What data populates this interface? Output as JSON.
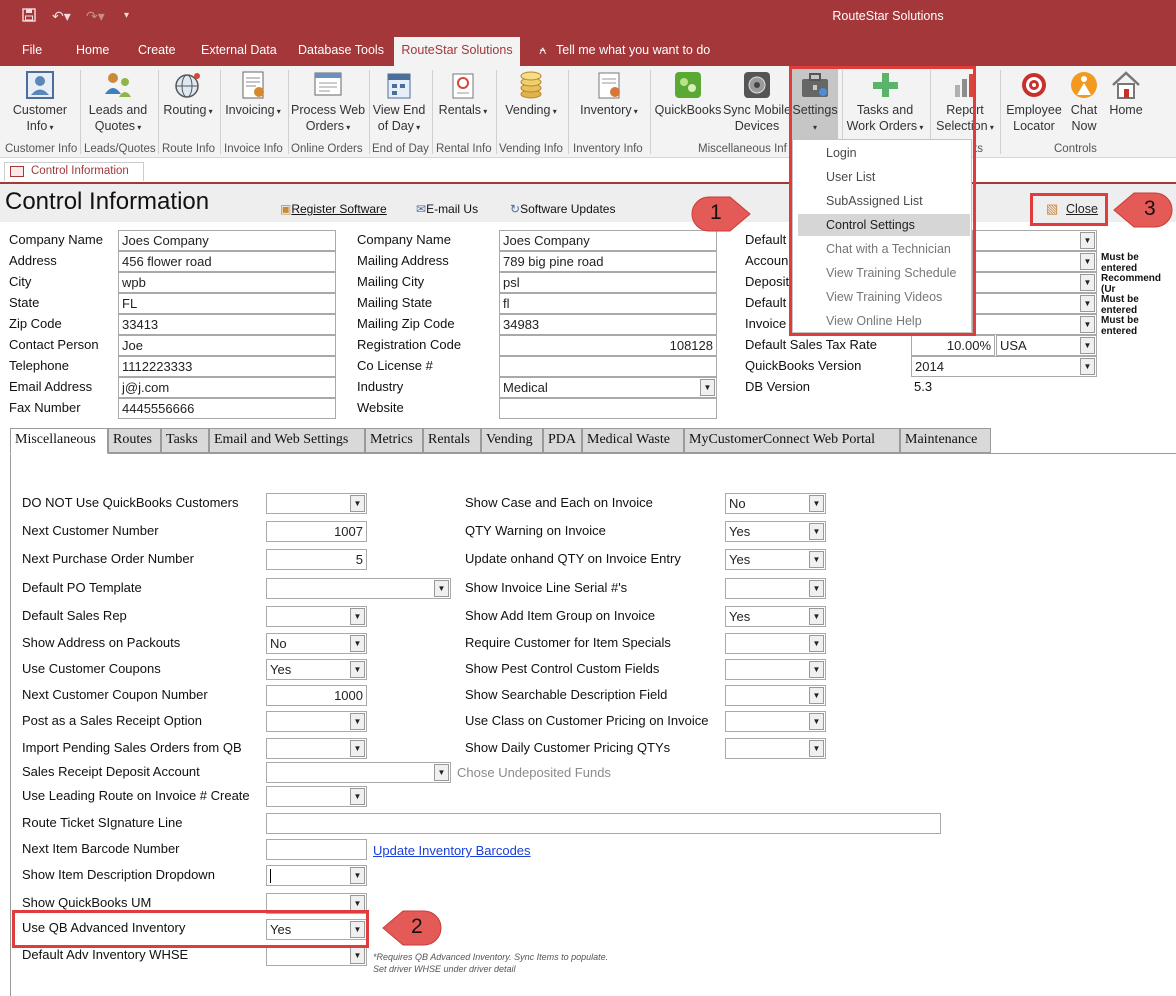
{
  "window": {
    "title": "RouteStar Solutions"
  },
  "menu_tabs": [
    "File",
    "Home",
    "Create",
    "External Data",
    "Database Tools",
    "RouteStar Solutions",
    "Tell me what you want to do"
  ],
  "ribbon": {
    "buttons": [
      {
        "label": "Customer\nInfo",
        "icon": "customer-info-icon"
      },
      {
        "label": "Leads and\nQuotes",
        "icon": "leads-quotes-icon"
      },
      {
        "label": "Routing",
        "icon": "routing-globe-icon"
      },
      {
        "label": "Invoicing",
        "icon": "invoice-icon"
      },
      {
        "label": "Process Web\nOrders",
        "icon": "web-orders-icon"
      },
      {
        "label": "View End\nof Day",
        "icon": "end-of-day-icon"
      },
      {
        "label": "Rentals",
        "icon": "rentals-icon"
      },
      {
        "label": "Vending",
        "icon": "vending-coins-icon"
      },
      {
        "label": "Inventory",
        "icon": "inventory-icon"
      },
      {
        "label": "QuickBooks",
        "icon": "quickbooks-icon"
      },
      {
        "label": "Sync Mobile\nDevices",
        "icon": "sync-mobile-icon"
      },
      {
        "label": "Settings",
        "icon": "settings-toolbox-icon"
      },
      {
        "label": "Tasks and\nWork Orders",
        "icon": "tasks-plus-icon"
      },
      {
        "label": "Report\nSelection",
        "icon": "report-selection-icon"
      },
      {
        "label": "Employee\nLocator",
        "icon": "employee-locator-icon"
      },
      {
        "label": "Chat\nNow",
        "icon": "chat-now-icon"
      },
      {
        "label": "Home",
        "icon": "home-icon"
      }
    ],
    "groups": [
      "Customer Info",
      "Leads/Quotes",
      "Route Info",
      "Invoice Info",
      "Online Orders",
      "End of Day",
      "Rental Info",
      "Vending Info",
      "Inventory Info",
      "Miscellaneous Inf",
      "ts",
      "Controls"
    ]
  },
  "settings_menu": [
    "Login",
    "User List",
    "SubAssigned List",
    "Control Settings",
    "Chat with a Technician",
    "View Training Schedule",
    "View Training Videos",
    "View Online Help"
  ],
  "doc_tab": "Control Information",
  "header": {
    "title": "Control Information",
    "register": "Register Software",
    "email": "E-mail Us",
    "updates": "Software Updates",
    "close": "Close"
  },
  "company": {
    "labels": [
      "Company Name",
      "Address",
      "City",
      "State",
      "Zip Code",
      "Contact Person",
      "Telephone",
      "Email Address",
      "Fax Number"
    ],
    "values": [
      "Joes Company",
      "456 flower road",
      "wpb",
      "FL",
      "33413",
      "Joe",
      "1112223333",
      "j@j.com",
      "4445556666"
    ]
  },
  "mailing": {
    "labels": [
      "Company Name",
      "Mailing Address",
      "Mailing City",
      "Mailing State",
      "Mailing Zip Code",
      "Registration Code",
      "Co License #",
      "Industry",
      "Website"
    ],
    "values": [
      "Joes Company",
      "789 big pine road",
      "psl",
      "fl",
      "34983",
      "108128",
      "",
      "Medical",
      ""
    ]
  },
  "defaults": {
    "labels": [
      "Default",
      "Accoun",
      "Deposit",
      "Default",
      "Invoice",
      "Default Sales Tax Rate",
      "QuickBooks Version",
      "DB Version"
    ],
    "tax_rate": "10.00%",
    "tax_region": "USA",
    "qb_version": "2014",
    "db_version": "5.3",
    "notes": [
      "Must be entered",
      "Recommend (Ur",
      "Must be entered",
      "Must be entered"
    ]
  },
  "tabs": [
    "Miscellaneous",
    "Routes",
    "Tasks",
    "Email and Web Settings",
    "Metrics",
    "Rentals",
    "Vending",
    "PDA",
    "Medical Waste",
    "MyCustomerConnect Web Portal",
    "Maintenance"
  ],
  "misc_left": [
    {
      "label": "DO NOT Use QuickBooks Customers",
      "value": ""
    },
    {
      "label": "Next Customer Number",
      "value": "1007"
    },
    {
      "label": "Next Purchase Order Number",
      "value": "5"
    },
    {
      "label": "Default PO Template",
      "value": ""
    },
    {
      "label": "Default Sales Rep",
      "value": ""
    },
    {
      "label": "Show Address on Packouts",
      "value": "No"
    },
    {
      "label": "Use Customer Coupons",
      "value": "Yes"
    },
    {
      "label": "Next Customer Coupon Number",
      "value": "1000"
    },
    {
      "label": "Post as a Sales Receipt Option",
      "value": ""
    },
    {
      "label": "Import Pending Sales Orders from QB",
      "value": ""
    },
    {
      "label": "Sales Receipt Deposit Account",
      "value": ""
    },
    {
      "label": "Use Leading Route on Invoice # Create",
      "value": ""
    },
    {
      "label": "Route Ticket SIgnature Line",
      "value": ""
    },
    {
      "label": "Next Item Barcode Number",
      "value": ""
    },
    {
      "label": "Show Item Description Dropdown",
      "value": ""
    },
    {
      "label": "Show QuickBooks UM",
      "value": ""
    },
    {
      "label": "Use QB Advanced Inventory",
      "value": "Yes"
    },
    {
      "label": "Default Adv Inventory WHSE",
      "value": ""
    }
  ],
  "misc_right": [
    {
      "label": "Show Case and Each on Invoice",
      "value": "No"
    },
    {
      "label": "QTY Warning on Invoice",
      "value": "Yes"
    },
    {
      "label": "Update onhand QTY on Invoice Entry",
      "value": "Yes"
    },
    {
      "label": "Show Invoice Line Serial #'s",
      "value": ""
    },
    {
      "label": "Show Add Item Group on Invoice",
      "value": "Yes"
    },
    {
      "label": "Require Customer for Item Specials",
      "value": ""
    },
    {
      "label": "Show Pest Control Custom Fields",
      "value": ""
    },
    {
      "label": "Show Searchable Description Field",
      "value": ""
    },
    {
      "label": "Use Class on Customer Pricing on Invoice",
      "value": ""
    },
    {
      "label": "Show Daily Customer Pricing QTYs",
      "value": ""
    }
  ],
  "undeposited_hint": "Chose Undeposited Funds",
  "update_barcodes": "Update Inventory Barcodes",
  "adv_inventory_note": [
    "*Requires QB Advanced Inventory. Sync Items to populate.",
    "Set driver WHSE under driver detail"
  ],
  "callouts": [
    "1",
    "2",
    "3"
  ],
  "colors": {
    "access_red": "#a4373a",
    "annotation_red": "#e13c3c"
  }
}
